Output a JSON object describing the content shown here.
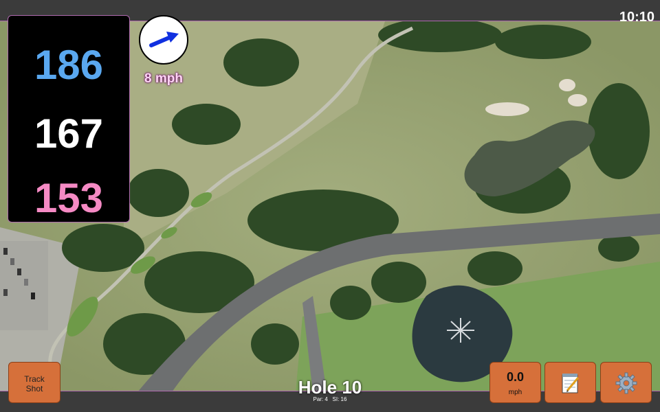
{
  "clock": "10:10",
  "yardages": {
    "back": "186",
    "middle": "167",
    "front": "153"
  },
  "wind": {
    "speed_label": "8 mph",
    "arrow_icon": "wind-direction-arrow-icon",
    "arrow_color": "#1030e0"
  },
  "buttons": {
    "track_shot": "Track\nShot",
    "wind_value": "0.0",
    "wind_unit": "mph",
    "notes_icon": "notepad-icon",
    "settings_icon": "gear-icon"
  },
  "hole": {
    "title": "Hole 10",
    "par": "Par: 4",
    "si": "SI: 16"
  },
  "colors": {
    "button": "#d6703a",
    "back_yardage": "#5aa8f0",
    "front_yardage": "#f58ac4",
    "border_accent": "#b06ab0"
  }
}
